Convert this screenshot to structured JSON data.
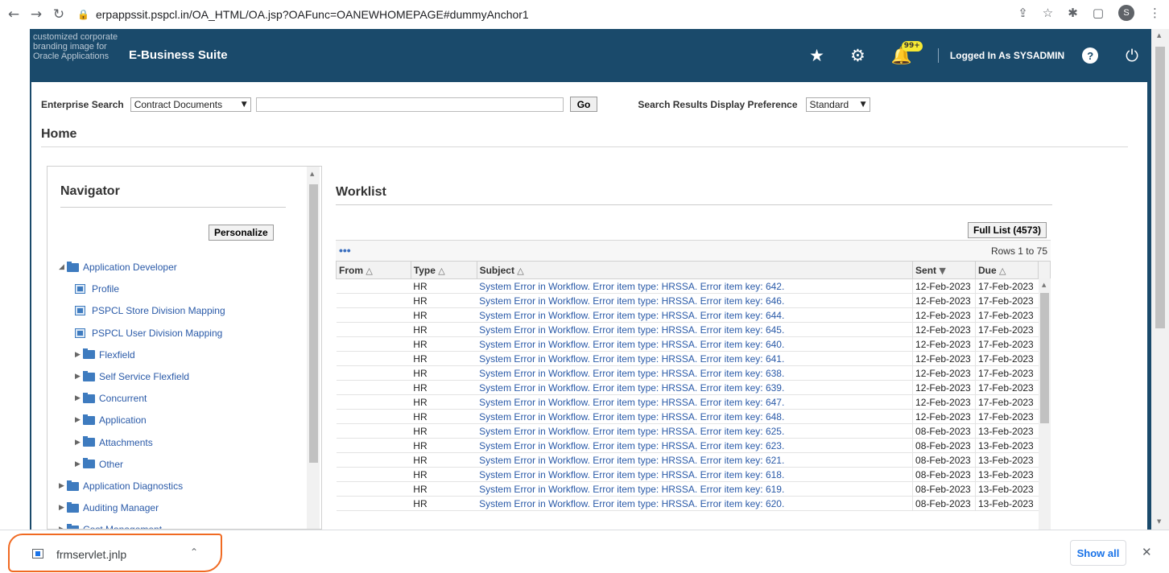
{
  "browser": {
    "url": "erpappssit.pspcl.in/OA_HTML/OA.jsp?OAFunc=OANEWHOMEPAGE#dummyAnchor1",
    "profile_initial": "S"
  },
  "header": {
    "brand_alt": "customized corporate branding image for Oracle Applications",
    "title": "E-Business Suite",
    "notification_badge": "99+",
    "logged_in_prefix": "Logged In As",
    "user": "SYSADMIN"
  },
  "search": {
    "label": "Enterprise Search",
    "category": "Contract Documents",
    "go_label": "Go",
    "pref_label": "Search Results Display Preference",
    "pref_value": "Standard"
  },
  "page_title": "Home",
  "navigator": {
    "title": "Navigator",
    "personalize_label": "Personalize",
    "items": [
      {
        "label": "Application Developer",
        "type": "folder-open"
      },
      {
        "label": "Profile",
        "type": "function"
      },
      {
        "label": "PSPCL Store Division Mapping",
        "type": "function"
      },
      {
        "label": "PSPCL User Division Mapping",
        "type": "function"
      },
      {
        "label": "Flexfield",
        "type": "folder"
      },
      {
        "label": "Self Service Flexfield",
        "type": "folder"
      },
      {
        "label": "Concurrent",
        "type": "folder"
      },
      {
        "label": "Application",
        "type": "folder"
      },
      {
        "label": "Attachments",
        "type": "folder"
      },
      {
        "label": "Other",
        "type": "folder"
      },
      {
        "label": "Application Diagnostics",
        "type": "folder"
      },
      {
        "label": "Auditing Manager",
        "type": "folder"
      },
      {
        "label": "Cost Management",
        "type": "folder"
      }
    ]
  },
  "worklist": {
    "title": "Worklist",
    "full_list_label": "Full List (4573)",
    "more_label": "•••",
    "rows_info": "Rows 1 to 75",
    "columns": [
      "From",
      "Type",
      "Subject",
      "Sent",
      "Due"
    ],
    "rows": [
      {
        "from": "",
        "type": "HR",
        "subject": "System Error in Workflow. Error item type: HRSSA. Error item key: 642.",
        "sent": "12-Feb-2023",
        "due": "17-Feb-2023"
      },
      {
        "from": "",
        "type": "HR",
        "subject": "System Error in Workflow. Error item type: HRSSA. Error item key: 646.",
        "sent": "12-Feb-2023",
        "due": "17-Feb-2023"
      },
      {
        "from": "",
        "type": "HR",
        "subject": "System Error in Workflow. Error item type: HRSSA. Error item key: 644.",
        "sent": "12-Feb-2023",
        "due": "17-Feb-2023"
      },
      {
        "from": "",
        "type": "HR",
        "subject": "System Error in Workflow. Error item type: HRSSA. Error item key: 645.",
        "sent": "12-Feb-2023",
        "due": "17-Feb-2023"
      },
      {
        "from": "",
        "type": "HR",
        "subject": "System Error in Workflow. Error item type: HRSSA. Error item key: 640.",
        "sent": "12-Feb-2023",
        "due": "17-Feb-2023"
      },
      {
        "from": "",
        "type": "HR",
        "subject": "System Error in Workflow. Error item type: HRSSA. Error item key: 641.",
        "sent": "12-Feb-2023",
        "due": "17-Feb-2023"
      },
      {
        "from": "",
        "type": "HR",
        "subject": "System Error in Workflow. Error item type: HRSSA. Error item key: 638.",
        "sent": "12-Feb-2023",
        "due": "17-Feb-2023"
      },
      {
        "from": "",
        "type": "HR",
        "subject": "System Error in Workflow. Error item type: HRSSA. Error item key: 639.",
        "sent": "12-Feb-2023",
        "due": "17-Feb-2023"
      },
      {
        "from": "",
        "type": "HR",
        "subject": "System Error in Workflow. Error item type: HRSSA. Error item key: 647.",
        "sent": "12-Feb-2023",
        "due": "17-Feb-2023"
      },
      {
        "from": "",
        "type": "HR",
        "subject": "System Error in Workflow. Error item type: HRSSA. Error item key: 648.",
        "sent": "12-Feb-2023",
        "due": "17-Feb-2023"
      },
      {
        "from": "",
        "type": "HR",
        "subject": "System Error in Workflow. Error item type: HRSSA. Error item key: 625.",
        "sent": "08-Feb-2023",
        "due": "13-Feb-2023"
      },
      {
        "from": "",
        "type": "HR",
        "subject": "System Error in Workflow. Error item type: HRSSA. Error item key: 623.",
        "sent": "08-Feb-2023",
        "due": "13-Feb-2023"
      },
      {
        "from": "",
        "type": "HR",
        "subject": "System Error in Workflow. Error item type: HRSSA. Error item key: 621.",
        "sent": "08-Feb-2023",
        "due": "13-Feb-2023"
      },
      {
        "from": "",
        "type": "HR",
        "subject": "System Error in Workflow. Error item type: HRSSA. Error item key: 618.",
        "sent": "08-Feb-2023",
        "due": "13-Feb-2023"
      },
      {
        "from": "",
        "type": "HR",
        "subject": "System Error in Workflow. Error item type: HRSSA. Error item key: 619.",
        "sent": "08-Feb-2023",
        "due": "13-Feb-2023"
      },
      {
        "from": "",
        "type": "HR",
        "subject": "System Error in Workflow. Error item type: HRSSA. Error item key: 620.",
        "sent": "08-Feb-2023",
        "due": "13-Feb-2023"
      }
    ]
  },
  "download": {
    "file_name": "frmservlet.jnlp",
    "show_all_label": "Show all"
  },
  "icons": {
    "back": "back-arrow-icon",
    "forward": "forward-arrow-icon",
    "reload": "reload-icon",
    "lock": "lock-icon",
    "favorites": "star-icon",
    "settings": "gear-icon",
    "notifications": "bell-icon",
    "help": "help-icon",
    "logout": "power-icon"
  },
  "colors": {
    "header_bg": "#1a4a6b",
    "link": "#2a5aa8",
    "badge": "#f5e834",
    "highlight_outline": "#f06a22"
  }
}
